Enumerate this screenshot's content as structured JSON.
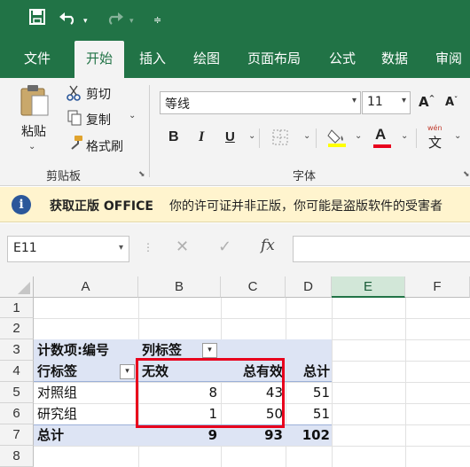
{
  "colors": {
    "accent": "#217346",
    "highlight": "#e8001c",
    "pivot_header": "#dde4f4",
    "notice_bg": "#fff4ce"
  },
  "tabs": [
    {
      "label": "文件"
    },
    {
      "label": "开始"
    },
    {
      "label": "插入"
    },
    {
      "label": "绘图"
    },
    {
      "label": "页面布局"
    },
    {
      "label": "公式"
    },
    {
      "label": "数据"
    },
    {
      "label": "审阅"
    }
  ],
  "ribbon": {
    "clipboard": {
      "paste": "粘贴",
      "cut": "剪切",
      "copy": "复制",
      "format_painter": "格式刷",
      "group_label": "剪贴板"
    },
    "font": {
      "font_name": "等线",
      "font_size": "11",
      "bold": "B",
      "italic": "I",
      "underline": "U",
      "grow": "A",
      "shrink": "A",
      "font_color": "A",
      "phonetic_top": "wén",
      "phonetic_char": "文",
      "group_label": "字体"
    }
  },
  "notice": {
    "title": "获取正版 OFFICE",
    "message": "你的许可证并非正版，你可能是盗版软件的受害者"
  },
  "formula_bar": {
    "name_box": "E11",
    "fx": "fx",
    "value": ""
  },
  "sheet": {
    "columns": [
      "A",
      "B",
      "C",
      "D",
      "E",
      "F"
    ],
    "selected_column": "E",
    "rows": [
      "1",
      "2",
      "3",
      "4",
      "5",
      "6",
      "7",
      "8"
    ],
    "pivot": {
      "count_label": "计数项:编号",
      "col_labels": "列标签",
      "row_labels": "行标签",
      "headers": [
        "无效",
        "总有效",
        "总计"
      ],
      "rows": [
        {
          "label": "对照组",
          "invalid": "8",
          "valid": "43",
          "total": "51"
        },
        {
          "label": "研究组",
          "invalid": "1",
          "valid": "50",
          "total": "51"
        }
      ],
      "grand_total": {
        "label": "总计",
        "invalid": "9",
        "valid": "93",
        "total": "102"
      }
    }
  }
}
